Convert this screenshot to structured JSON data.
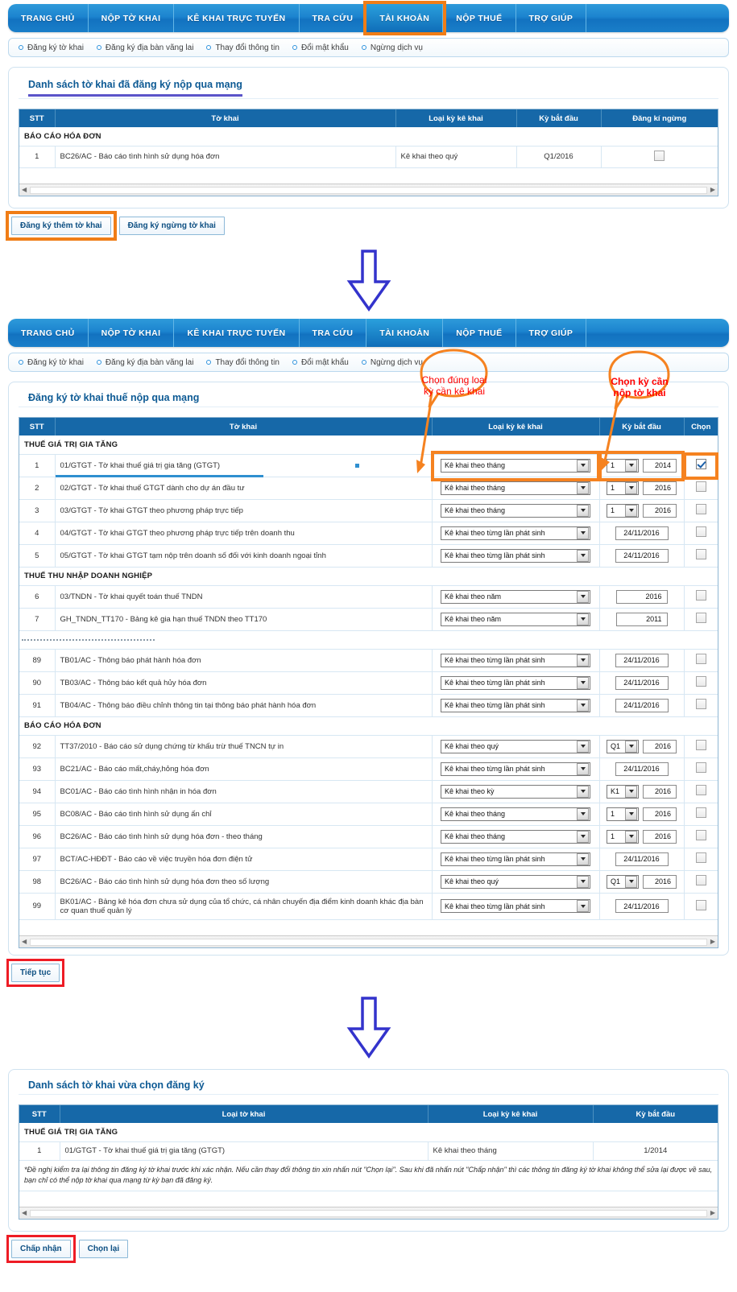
{
  "nav": {
    "tabs": [
      {
        "label": "TRANG CHỦ",
        "active": false
      },
      {
        "label": "NỘP TỜ KHAI",
        "active": false
      },
      {
        "label": "KÊ KHAI TRỰC TUYẾN",
        "active": false
      },
      {
        "label": "TRA CỨU",
        "active": false
      },
      {
        "label": "TÀI KHOẢN",
        "active": true
      },
      {
        "label": "NỘP THUẾ",
        "active": false
      },
      {
        "label": "TRỢ GIÚP",
        "active": false
      }
    ]
  },
  "subnav": {
    "items": [
      {
        "label": "Đăng ký tờ khai"
      },
      {
        "label": "Đăng ký địa bàn vãng lai"
      },
      {
        "label": "Thay đổi thông tin"
      },
      {
        "label": "Đổi mật khẩu"
      },
      {
        "label": "Ngừng dịch vụ"
      }
    ]
  },
  "panel1": {
    "title": "Danh sách tờ khai đã đăng ký nộp qua mạng",
    "columns": [
      "STT",
      "Tờ khai",
      "Loại kỳ kê khai",
      "Kỳ bắt đầu",
      "Đăng kí ngừng"
    ],
    "group": "BÁO CÁO HÓA ĐƠN",
    "rows": [
      {
        "stt": "1",
        "tokhai": "BC26/AC - Báo cáo tình hình sử dụng hóa đơn",
        "loaiky": "Kê khai theo quý",
        "kybatdau": "Q1/2016",
        "checked": false
      }
    ],
    "buttons": [
      {
        "label": "Đăng ký thêm tờ khai",
        "highlight": "orange"
      },
      {
        "label": "Đăng ký ngừng tờ khai",
        "highlight": "none"
      }
    ]
  },
  "panel2": {
    "title": "Đăng ký tờ khai thuế nộp qua mạng",
    "columns": [
      "STT",
      "Tờ khai",
      "Loại kỳ kê khai",
      "Kỳ bắt đầu",
      "Chọn"
    ],
    "callouts": [
      {
        "text": "Chọn đúng loại kỳ cần kê khai",
        "bold": false
      },
      {
        "text": "Chọn kỳ cần nộp tờ khai",
        "bold": true
      }
    ],
    "sections": [
      {
        "group": "THUẾ GIÁ TRỊ GIA TĂNG",
        "rows": [
          {
            "stt": "1",
            "tokhai": "01/GTGT - Tờ khai thuế giá trị gia tăng (GTGT)",
            "loaiky": "Kê khai theo tháng",
            "period_type": "num",
            "period": "1",
            "year": "2014",
            "checked": true,
            "highlighted": true
          },
          {
            "stt": "2",
            "tokhai": "02/GTGT - Tờ khai thuế GTGT dành cho dự án đầu tư",
            "loaiky": "Kê khai theo tháng",
            "period_type": "num",
            "period": "1",
            "year": "2016",
            "checked": false
          },
          {
            "stt": "3",
            "tokhai": "03/GTGT - Tờ khai GTGT theo phương pháp trực tiếp",
            "loaiky": "Kê khai theo tháng",
            "period_type": "num",
            "period": "1",
            "year": "2016",
            "checked": false
          },
          {
            "stt": "4",
            "tokhai": "04/GTGT - Tờ khai GTGT theo phương pháp trực tiếp trên doanh thu",
            "loaiky": "Kê khai theo từng lần phát sinh",
            "period_type": "date",
            "date": "24/11/2016",
            "checked": false
          },
          {
            "stt": "5",
            "tokhai": "05/GTGT - Tờ khai GTGT tạm nộp trên doanh số đối với kinh doanh ngoại tỉnh",
            "loaiky": "Kê khai theo từng lần phát sinh",
            "period_type": "date",
            "date": "24/11/2016",
            "checked": false
          }
        ]
      },
      {
        "group": "THUẾ THU NHẬP DOANH NGHIỆP",
        "rows": [
          {
            "stt": "6",
            "tokhai": "03/TNDN - Tờ khai quyết toán thuế TNDN",
            "loaiky": "Kê khai theo năm",
            "period_type": "year",
            "year": "2016",
            "checked": false
          },
          {
            "stt": "7",
            "tokhai": "GH_TNDN_TT170 - Bảng kê gia hạn thuế TNDN theo TT170",
            "loaiky": "Kê khai theo năm",
            "period_type": "year",
            "year": "2011",
            "checked": false
          }
        ]
      },
      {
        "group": "",
        "rows": [
          {
            "stt": "89",
            "tokhai": "TB01/AC - Thông báo phát hành hóa đơn",
            "loaiky": "Kê khai theo từng lần phát sinh",
            "period_type": "date",
            "date": "24/11/2016",
            "checked": false
          },
          {
            "stt": "90",
            "tokhai": "TB03/AC - Thông báo kết quả hủy hóa đơn",
            "loaiky": "Kê khai theo từng lần phát sinh",
            "period_type": "date",
            "date": "24/11/2016",
            "checked": false
          },
          {
            "stt": "91",
            "tokhai": "TB04/AC - Thông báo điều chỉnh thông tin tại thông báo phát hành hóa đơn",
            "loaiky": "Kê khai theo từng lần phát sinh",
            "period_type": "date",
            "date": "24/11/2016",
            "checked": false
          }
        ]
      },
      {
        "group": "BÁO CÁO HÓA ĐƠN",
        "rows": [
          {
            "stt": "92",
            "tokhai": "TT37/2010 - Báo cáo sử dụng chứng từ khấu trừ thuế TNCN tự in",
            "loaiky": "Kê khai theo quý",
            "period_type": "num",
            "period": "Q1",
            "year": "2016",
            "checked": false
          },
          {
            "stt": "93",
            "tokhai": "BC21/AC - Báo cáo mất,cháy,hỏng hóa đơn",
            "loaiky": "Kê khai theo từng lần phát sinh",
            "period_type": "date",
            "date": "24/11/2016",
            "checked": false
          },
          {
            "stt": "94",
            "tokhai": "BC01/AC - Báo cáo tình hình nhận in hóa đơn",
            "loaiky": "Kê khai theo kỳ",
            "period_type": "num",
            "period": "K1",
            "year": "2016",
            "checked": false
          },
          {
            "stt": "95",
            "tokhai": "BC08/AC - Báo cáo tình hình sử dụng ấn chỉ",
            "loaiky": "Kê khai theo tháng",
            "period_type": "num",
            "period": "1",
            "year": "2016",
            "checked": false
          },
          {
            "stt": "96",
            "tokhai": "BC26/AC - Báo cáo tình hình sử dụng hóa đơn - theo tháng",
            "loaiky": "Kê khai theo tháng",
            "period_type": "num",
            "period": "1",
            "year": "2016",
            "checked": false
          },
          {
            "stt": "97",
            "tokhai": "BCT/AC-HĐĐT - Báo cáo về việc truyền hóa đơn điện tử",
            "loaiky": "Kê khai theo từng lần phát sinh",
            "period_type": "date",
            "date": "24/11/2016",
            "checked": false
          },
          {
            "stt": "98",
            "tokhai": "BC26/AC - Báo cáo tình hình sử dụng hóa đơn theo số lượng",
            "loaiky": "Kê khai theo quý",
            "period_type": "num",
            "period": "Q1",
            "year": "2016",
            "checked": false
          },
          {
            "stt": "99",
            "tokhai": "BK01/AC - Bảng kê hóa đơn chưa sử dụng của tổ chức, cá nhân chuyến địa điểm kinh doanh khác địa bàn cơ quan thuế quản lý",
            "loaiky": "Kê khai theo từng lần phát sinh",
            "period_type": "date",
            "date": "24/11/2016",
            "checked": false
          }
        ]
      }
    ],
    "button": {
      "label": "Tiếp tục",
      "highlight": "red"
    }
  },
  "panel3": {
    "title": "Danh sách tờ khai vừa chọn đăng ký",
    "columns": [
      "STT",
      "Loại tờ khai",
      "Loại kỳ kê khai",
      "Kỳ bắt đầu"
    ],
    "group": "THUẾ GIÁ TRỊ GIA TĂNG",
    "rows": [
      {
        "stt": "1",
        "tokhai": "01/GTGT - Tờ khai thuế giá trị gia tăng (GTGT)",
        "loaiky": "Kê khai theo tháng",
        "kybatdau": "1/2014"
      }
    ],
    "note": "*Đề nghị kiểm tra lại thông tin đăng ký tờ khai trước khi xác nhận. Nếu cần thay đổi thông tin xin nhấn nút \"Chọn lại\". Sau khi đã nhấn nút \"Chấp nhận\" thì các thông tin đăng ký tờ khai không thể sửa lại được về sau, bạn chỉ có thể nộp tờ khai qua mạng từ kỳ bạn đã đăng ký.",
    "buttons": [
      {
        "label": "Chấp nhận",
        "highlight": "red"
      },
      {
        "label": "Chọn lại",
        "highlight": "none"
      }
    ]
  },
  "colors": {
    "nav_blue": "#1c84cf",
    "header_blue": "#1668a8",
    "highlight_orange": "#f07d16",
    "highlight_red": "#ee1c25",
    "callout_red": "#ff0000",
    "arrow_blue": "#3333cc",
    "title_blue": "#0d5a94",
    "underline_purple": "#5a54c9"
  }
}
